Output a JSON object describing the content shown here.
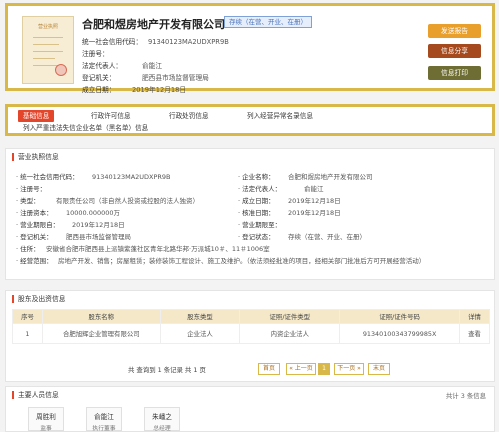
{
  "header": {
    "license_thumb_title": "营业执照",
    "company_name": "合肥和煜房地产开发有限公司",
    "status_tag": "存续（在营、开业、在册）",
    "fields": [
      {
        "label": "统一社会信用代码：",
        "value": "91340123MA2UDXPR9B"
      },
      {
        "label": "注册号：",
        "value": ""
      },
      {
        "label": "法定代表人：",
        "value": "俞能江"
      },
      {
        "label": "登记机关：",
        "value": "肥西县市场监督管理局"
      },
      {
        "label": "成立日期：",
        "value": "2019年12月18日"
      }
    ],
    "buttons": {
      "report": "发送报告",
      "share": "信息分享",
      "print": "信息打印"
    }
  },
  "tabs": {
    "row1": [
      "基础信息",
      "行政许可信息",
      "行政处罚信息",
      "列入经营异常名录信息"
    ],
    "row2": [
      "列入严重违法失信企业名单（黑名单）信息"
    ]
  },
  "basic": {
    "title": "营业执照信息",
    "left": [
      {
        "k": "· 统一社会信用代码：",
        "v": "91340123MA2UDXPR9B"
      },
      {
        "k": "· 注册号：",
        "v": ""
      },
      {
        "k": "· 类型：",
        "v": "有限责任公司（非自然人投资或控股的法人独资）"
      },
      {
        "k": "· 注册资本：",
        "v": "10000.000000万"
      },
      {
        "k": "· 营业期限自：",
        "v": "2019年12月18日"
      },
      {
        "k": "· 登记机关：",
        "v": "肥西县市场监督管理局"
      }
    ],
    "right": [
      {
        "k": "· 企业名称：",
        "v": "合肥和煜房地产开发有限公司"
      },
      {
        "k": "· 法定代表人：",
        "v": "俞能江"
      },
      {
        "k": "· 成立日期：",
        "v": "2019年12月18日"
      },
      {
        "k": "· 核准日期：",
        "v": "2019年12月18日"
      },
      {
        "k": "· 营业期限至：",
        "v": ""
      },
      {
        "k": "· 登记状态：",
        "v": "存续（在营、开业、在册）"
      }
    ],
    "address_label": "· 住所：",
    "address": "安徽省合肥市肥西县上派镇紫蓬社区青年北路华邦·万派城10＃、11＃1006室",
    "scope_label": "· 经营范围：",
    "scope": "房地产开发、销售；房屋租赁；装修装饰工程设计、施工及维护。（依法须经批准的项目，经相关部门批准后方可开展经营活动）"
  },
  "shareholders": {
    "title": "股东及出资信息",
    "columns": [
      "序号",
      "股东名称",
      "股东类型",
      "证照/证件类型",
      "证照/证件号码",
      "详情"
    ],
    "rows": [
      [
        "1",
        "合肥旭辉企业管理有限公司",
        "企业法人",
        "内资企业法人",
        "91340100343799985X",
        "查看"
      ]
    ],
    "pager_total": "共 查询到 1 条记录 共 1 页",
    "pager": {
      "first": "首页",
      "prev": "« 上一页",
      "current": "1",
      "next": "下一页 »",
      "last": "末页"
    }
  },
  "persons": {
    "title": "主要人员信息",
    "count": "共计 3 条信息",
    "list": [
      {
        "name": "周胜利",
        "role": "监事"
      },
      {
        "name": "俞能江",
        "role": "执行董事"
      },
      {
        "name": "朱嶓之",
        "role": "总经理"
      }
    ]
  }
}
